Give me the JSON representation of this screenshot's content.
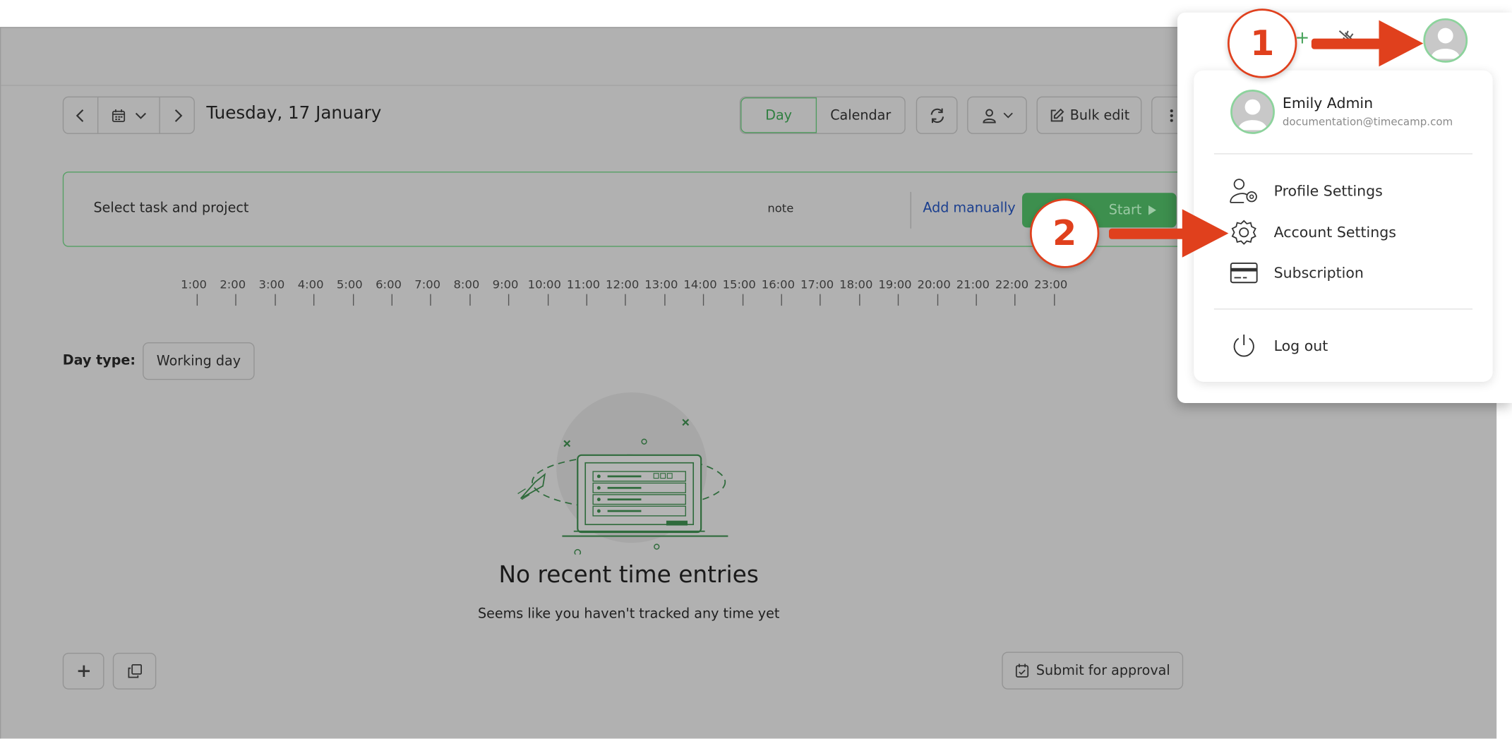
{
  "date_nav": {
    "title": "Tuesday, 17 January",
    "prev_icon": "chevron-left-icon",
    "calendar_icon": "calendar-icon",
    "next_icon": "chevron-right-icon"
  },
  "toolbar": {
    "day_label": "Day",
    "calendar_label": "Calendar",
    "bulk_edit_label": "Bulk edit",
    "refresh_icon": "refresh-icon",
    "user_icon": "user-icon",
    "more_icon": "more-icon"
  },
  "tracker": {
    "task_placeholder": "Select task and project",
    "note_placeholder": "note",
    "add_manually_label": "Add manually",
    "start_label": "Start"
  },
  "timeline": {
    "hours": [
      "1:00",
      "2:00",
      "3:00",
      "4:00",
      "5:00",
      "6:00",
      "7:00",
      "8:00",
      "9:00",
      "10:00",
      "11:00",
      "12:00",
      "13:00",
      "14:00",
      "15:00",
      "16:00",
      "17:00",
      "18:00",
      "19:00",
      "20:00",
      "21:00",
      "22:00",
      "23:00"
    ]
  },
  "day_type": {
    "label": "Day type:",
    "value": "Working day"
  },
  "empty_state": {
    "title": "No recent time entries",
    "subtitle": "Seems like you haven't tracked any time yet"
  },
  "footer": {
    "submit_label": "Submit for approval"
  },
  "user_menu": {
    "name": "Emily Admin",
    "email": "documentation@timecamp.com",
    "items": [
      {
        "label": "Profile Settings",
        "icon": "user-settings-icon"
      },
      {
        "label": "Account Settings",
        "icon": "gear-icon"
      },
      {
        "label": "Subscription",
        "icon": "credit-card-icon"
      },
      {
        "label": "Log out",
        "icon": "power-icon"
      }
    ]
  },
  "annotations": {
    "marker_1": "1",
    "marker_2": "2"
  },
  "colors": {
    "brand_green": "#3d8f4e",
    "annotation_red": "#e0401d",
    "overlay_gray": "#b1b1b1",
    "link_blue": "#1b3f8f"
  }
}
